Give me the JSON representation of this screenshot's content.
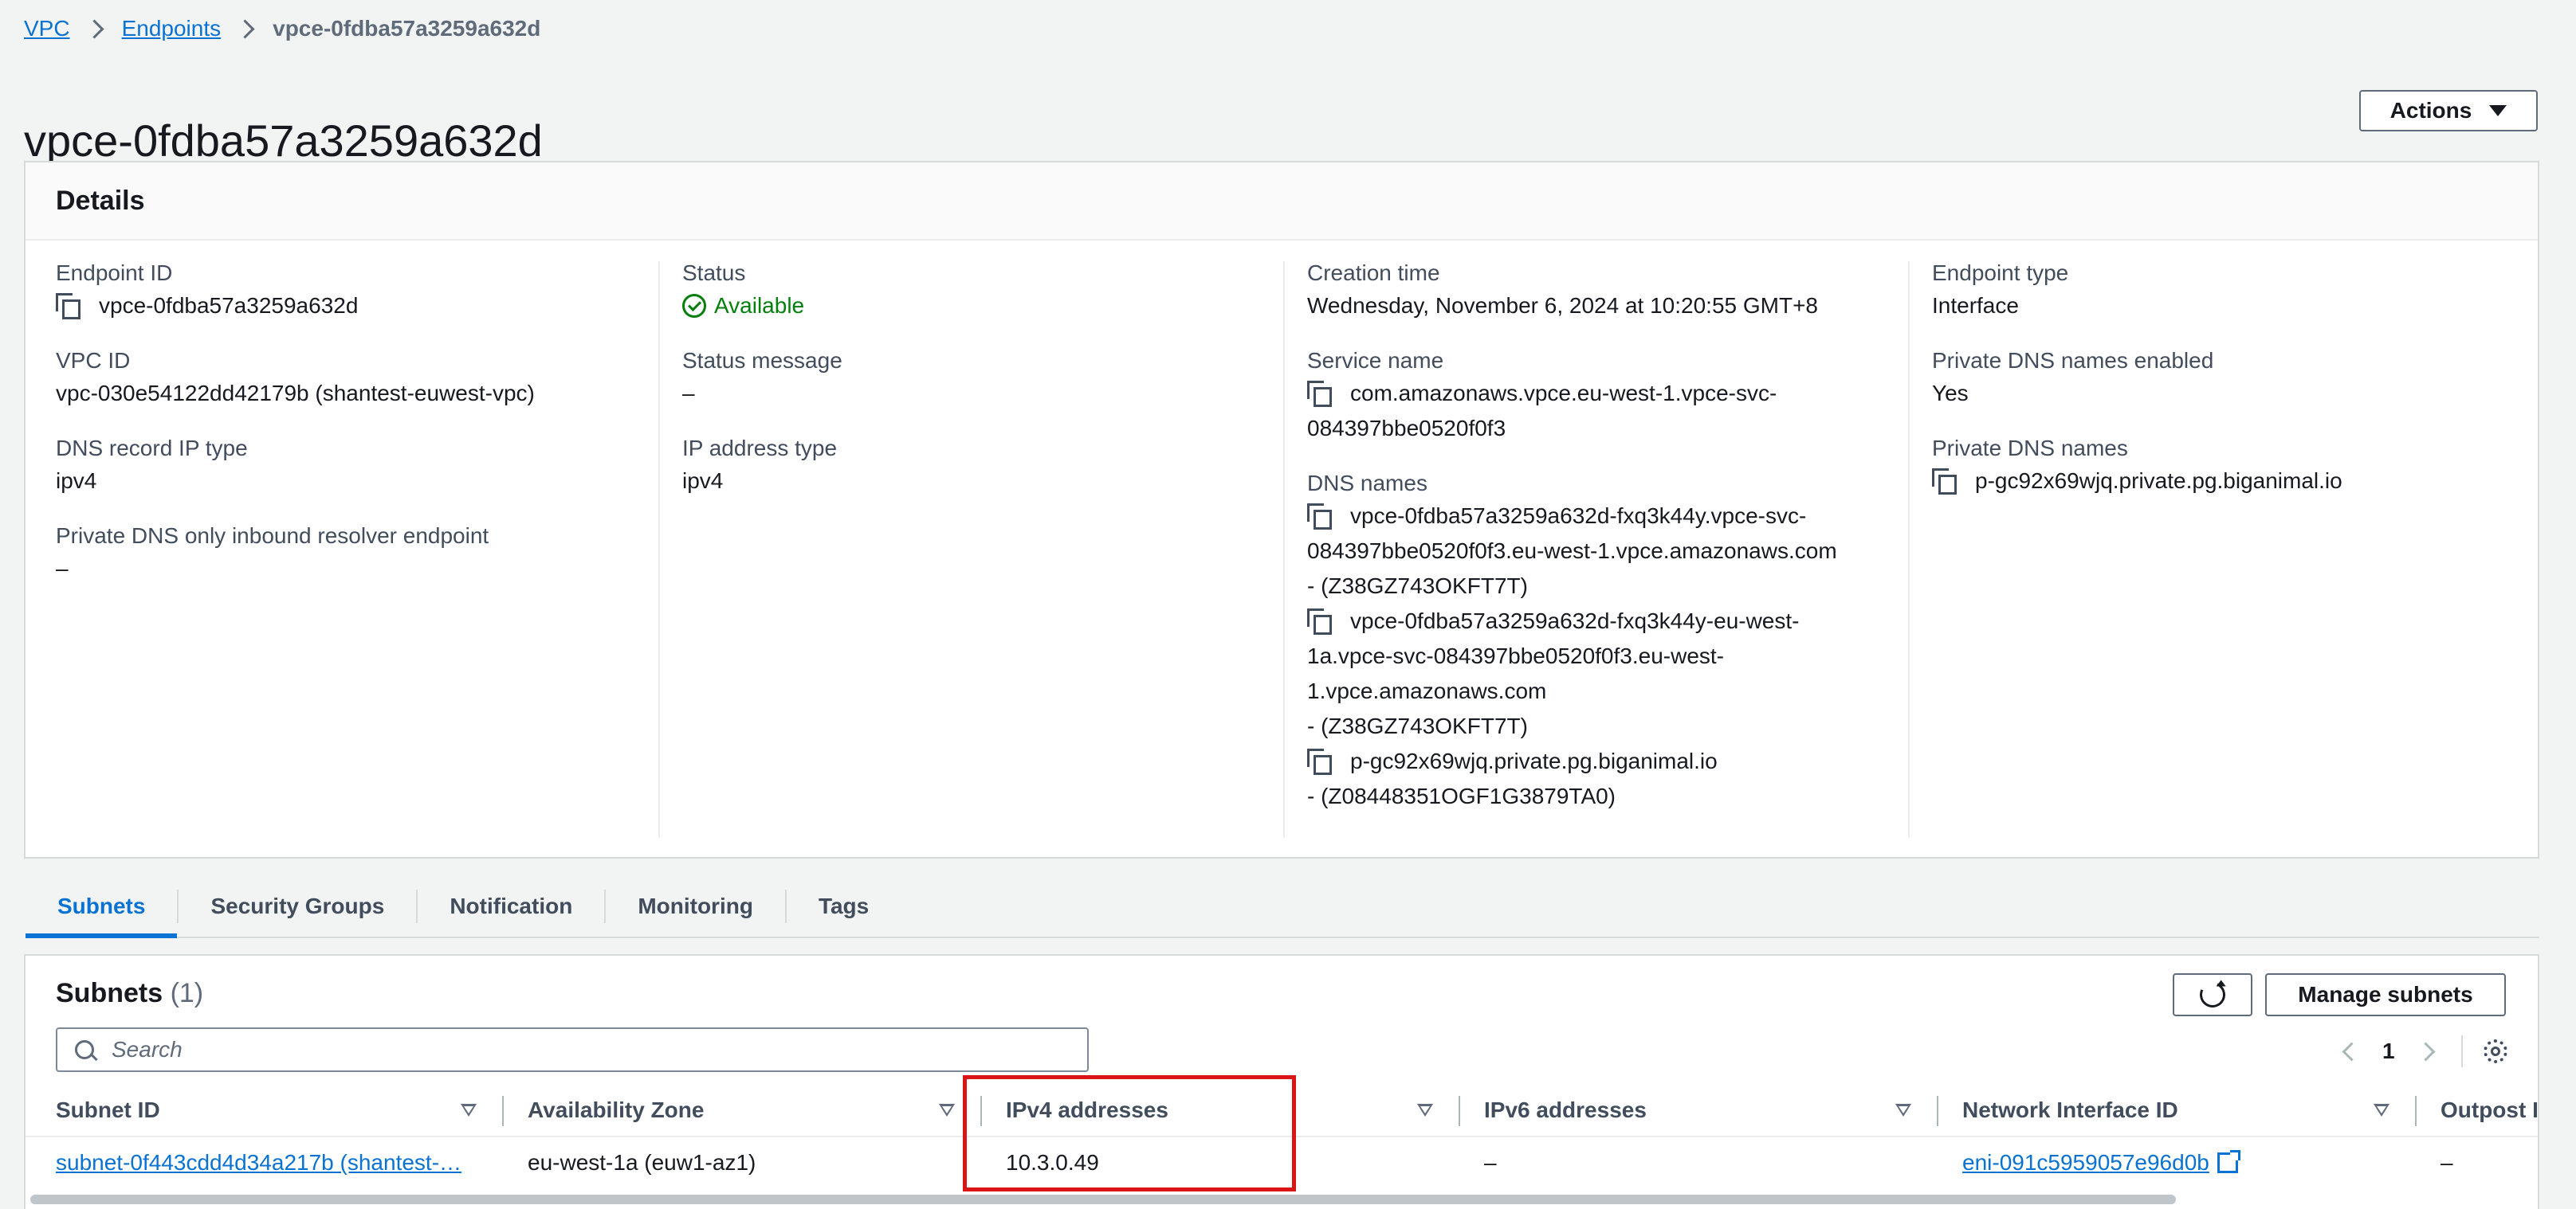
{
  "breadcrumb": {
    "items": [
      "VPC",
      "Endpoints"
    ],
    "current": "vpce-0fdba57a3259a632d"
  },
  "page": {
    "title": "vpce-0fdba57a3259a632d",
    "actions_label": "Actions"
  },
  "details": {
    "title": "Details",
    "endpoint_id_label": "Endpoint ID",
    "endpoint_id": "vpce-0fdba57a3259a632d",
    "vpc_id_label": "VPC ID",
    "vpc_id": "vpc-030e54122dd42179b (shantest-euwest-vpc)",
    "dns_record_ip_type_label": "DNS record IP type",
    "dns_record_ip_type": "ipv4",
    "private_dns_inbound_label": "Private DNS only inbound resolver endpoint",
    "private_dns_inbound": "–",
    "status_label": "Status",
    "status": "Available",
    "status_message_label": "Status message",
    "status_message": "–",
    "ip_address_type_label": "IP address type",
    "ip_address_type": "ipv4",
    "creation_time_label": "Creation time",
    "creation_time": "Wednesday, November 6, 2024 at 10:20:55 GMT+8",
    "service_name_label": "Service name",
    "service_name_l1": "com.amazonaws.vpce.eu-west-1.vpce-svc-",
    "service_name_l2": "084397bbe0520f0f3",
    "dns_names_label": "DNS names",
    "dns1_l1": "vpce-0fdba57a3259a632d-fxq3k44y.vpce-svc-",
    "dns1_l2": "084397bbe0520f0f3.eu-west-1.vpce.amazonaws.com",
    "dns1_l3": "- (Z38GZ743OKFT7T)",
    "dns2_l1": "vpce-0fdba57a3259a632d-fxq3k44y-eu-west-",
    "dns2_l2": "1a.vpce-svc-084397bbe0520f0f3.eu-west-",
    "dns2_l3": "1.vpce.amazonaws.com",
    "dns2_l4": "- (Z38GZ743OKFT7T)",
    "dns3_l1": "p-gc92x69wjq.private.pg.biganimal.io",
    "dns3_l2": "- (Z08448351OGF1G3879TA0)",
    "endpoint_type_label": "Endpoint type",
    "endpoint_type": "Interface",
    "private_dns_enabled_label": "Private DNS names enabled",
    "private_dns_enabled": "Yes",
    "private_dns_names_label": "Private DNS names",
    "private_dns_names": "p-gc92x69wjq.private.pg.biganimal.io"
  },
  "tabs": [
    "Subnets",
    "Security Groups",
    "Notification",
    "Monitoring",
    "Tags"
  ],
  "subnets": {
    "title": "Subnets",
    "count": "(1)",
    "manage_label": "Manage subnets",
    "search_placeholder": "Search",
    "page": "1",
    "columns": [
      "Subnet ID",
      "Availability Zone",
      "IPv4 addresses",
      "IPv6 addresses",
      "Network Interface ID",
      "Outpost I"
    ],
    "rows": [
      {
        "subnet_id": "subnet-0f443cdd4d34a217b (shantest-…",
        "az": "eu-west-1a (euw1-az1)",
        "ipv4": "10.3.0.49",
        "ipv6": "–",
        "eni": "eni-091c5959057e96d0b",
        "outpost": "–"
      }
    ]
  },
  "colors": {
    "link": "#0972d3",
    "success": "#037f0c",
    "highlight": "#d91515"
  }
}
